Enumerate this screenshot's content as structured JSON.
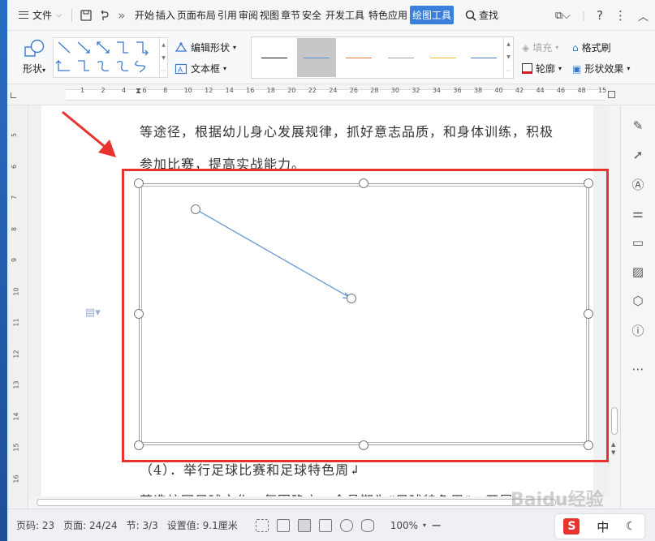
{
  "menubar": {
    "file_label": "文件",
    "more_label": "»",
    "tabs": [
      "开始",
      "插入",
      "页面布局",
      "引用",
      "审阅",
      "视图",
      "章节",
      "安全",
      "开发工具",
      "特色应用",
      "绘图工具"
    ],
    "active_tab": "绘图工具",
    "search_label": "查找"
  },
  "ribbon": {
    "shape_label": "形状",
    "edit_shape_label": "编辑形状",
    "textbox_label": "文本框",
    "fill_label": "填充",
    "outline_label": "轮廓",
    "format_brush_label": "格式刷",
    "shape_effect_label": "形状效果",
    "line_style_colors": [
      "#111111",
      "#5b8fd0",
      "#e07b3a",
      "#9aa0a8",
      "#f1b92e",
      "#4a78c0"
    ]
  },
  "ruler": {
    "h_ticks": [
      "1",
      "2",
      "4",
      "6",
      "8",
      "10",
      "12",
      "14",
      "16",
      "18",
      "20",
      "22",
      "24",
      "26",
      "28",
      "30",
      "32",
      "34",
      "36",
      "38",
      "40",
      "42",
      "44",
      "46",
      "48",
      "15"
    ],
    "v_ticks": [
      "5",
      "6",
      "7",
      "8",
      "9",
      "10",
      "11",
      "12",
      "13",
      "14",
      "15",
      "16"
    ]
  },
  "document": {
    "line1": "等途径，根据幼儿身心发展规律，抓好意志品质，和身体训练，积极",
    "line2": "参加比赛，提高实战能力。",
    "line3": "（4）．举行足球比赛和足球特色周↲",
    "line4": "营造校园足球文化，氛围确立，全县期为“足球特色周”，开展"
  },
  "statusbar": {
    "page_code": "页码: 23",
    "page": "页面: 24/24",
    "section": "节: 3/3",
    "setting": "设置值: 9.1厘米",
    "zoom": "100%",
    "ime_mode": "中"
  },
  "watermark": "Baidu经验"
}
